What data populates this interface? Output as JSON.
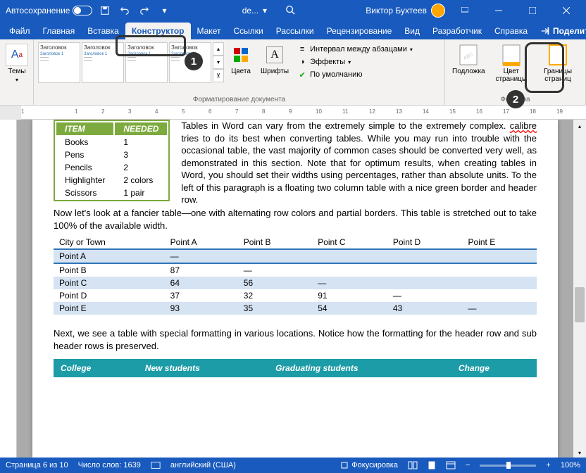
{
  "titlebar": {
    "autosave": "Автосохранение",
    "docname": "de...",
    "user": "Виктор Бухтеев"
  },
  "tabs": [
    "Файл",
    "Главная",
    "Вставка",
    "Конструктор",
    "Макет",
    "Ссылки",
    "Рассылки",
    "Рецензирование",
    "Вид",
    "Разработчик",
    "Справка"
  ],
  "share": "Поделиться",
  "ribbon": {
    "themes": "Темы",
    "style_title": "Заголовок",
    "style_sub": "Заголовок 1",
    "group_format": "Форматирование документа",
    "colors": "Цвета",
    "fonts": "Шрифты",
    "para_spacing": "Интервал между абзацами",
    "effects": "Эффекты",
    "default": "По умолчанию",
    "watermark": "Подложка",
    "page_color": "Цвет страницы",
    "page_borders": "Границы страниц",
    "group_bg": "Фон стра"
  },
  "ruler_marks": [
    "1",
    "",
    "1",
    "2",
    "3",
    "4",
    "5",
    "6",
    "7",
    "8",
    "9",
    "10",
    "11",
    "12",
    "13",
    "14",
    "15",
    "16",
    "17",
    "18",
    "19"
  ],
  "doc": {
    "items_header": [
      "ITEM",
      "NEEDED"
    ],
    "items_rows": [
      [
        "Books",
        "1"
      ],
      [
        "Pens",
        "3"
      ],
      [
        "Pencils",
        "2"
      ],
      [
        "Highlighter",
        "2 colors"
      ],
      [
        "Scissors",
        "1 pair"
      ]
    ],
    "para1a": "Tables in Word can vary from the extremely simple to the extremely complex. ",
    "para1_spell": "calibre",
    "para1b": " tries to do its best when converting tables. While you may run into trouble with the occasional table, the vast majority of common cases should be converted very well, as demonstrated in this section. Note that for optimum results, when creating tables in Word, you should set their widths using percentages, rather than absolute units.  To the left of this paragraph is a floating two column table with a nice green border and header row.",
    "para2": "Now let's look at a fancier table—one with alternating row colors and partial borders. This table is stretched out to take 100% of the available width.",
    "fancy_header": [
      "City or Town",
      "Point A",
      "Point B",
      "Point C",
      "Point D",
      "Point E"
    ],
    "fancy_rows": [
      [
        "Point A",
        "—",
        "",
        "",
        "",
        ""
      ],
      [
        "Point B",
        "87",
        "—",
        "",
        "",
        ""
      ],
      [
        "Point C",
        "64",
        "56",
        "—",
        "",
        ""
      ],
      [
        "Point D",
        "37",
        "32",
        "91",
        "—",
        ""
      ],
      [
        "Point E",
        "93",
        "35",
        "54",
        "43",
        "—"
      ]
    ],
    "para3": "Next, we see a table with special formatting in various locations. Notice how the formatting for the header row and sub header rows is preserved.",
    "teal_header": [
      "College",
      "New students",
      "Graduating students",
      "Change"
    ]
  },
  "status": {
    "page": "Страница 6 из 10",
    "words": "Число слов: 1639",
    "lang": "английский (США)",
    "focus": "Фокусировка",
    "zoom": "100%"
  }
}
